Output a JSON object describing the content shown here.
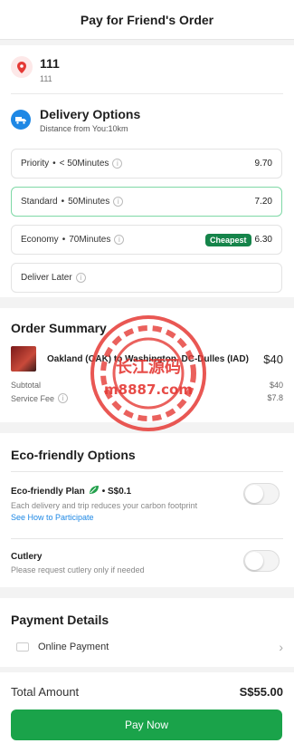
{
  "header": {
    "title": "Pay for Friend's Order"
  },
  "address": {
    "name": "111",
    "detail": "111"
  },
  "delivery": {
    "title": "Delivery Options",
    "distance": "Distance from You:10km",
    "options": [
      {
        "label": "Priority",
        "time": "< 50Minutes",
        "price": "9.70",
        "badge": ""
      },
      {
        "label": "Standard",
        "time": "50Minutes",
        "price": "7.20",
        "badge": ""
      },
      {
        "label": "Economy",
        "time": "70Minutes",
        "price": "6.30",
        "badge": "Cheapest"
      },
      {
        "label": "Deliver Later",
        "time": "",
        "price": "",
        "badge": ""
      }
    ]
  },
  "summary": {
    "title": "Order Summary",
    "item_name": "Oakland (OAK) to Washington, DC-Dulles (IAD)",
    "item_price": "$40",
    "subtotal_label": "Subtotal",
    "subtotal_value": "$40",
    "service_label": "Service Fee",
    "service_value": "$7.8"
  },
  "eco": {
    "title": "Eco-friendly Options",
    "plan_title": "Eco-friendly Plan",
    "plan_price": "• S$0.1",
    "plan_desc": "Each delivery and trip reduces your carbon footprint",
    "plan_link": "See How to Participate",
    "cutlery_title": "Cutlery",
    "cutlery_desc": "Please request cutlery only if needed"
  },
  "payment": {
    "title": "Payment Details",
    "method": "Online Payment"
  },
  "footer": {
    "total_label": "Total Amount",
    "total_value": "S$55.00",
    "pay_label": "Pay Now"
  },
  "watermark": {
    "text1": "长江源码",
    "text2": "m8887.com"
  },
  "colors": {
    "accent": "#1aa34a",
    "badge": "#15844a",
    "link": "#1e88e5",
    "selected_border": "#7fd8a6"
  }
}
